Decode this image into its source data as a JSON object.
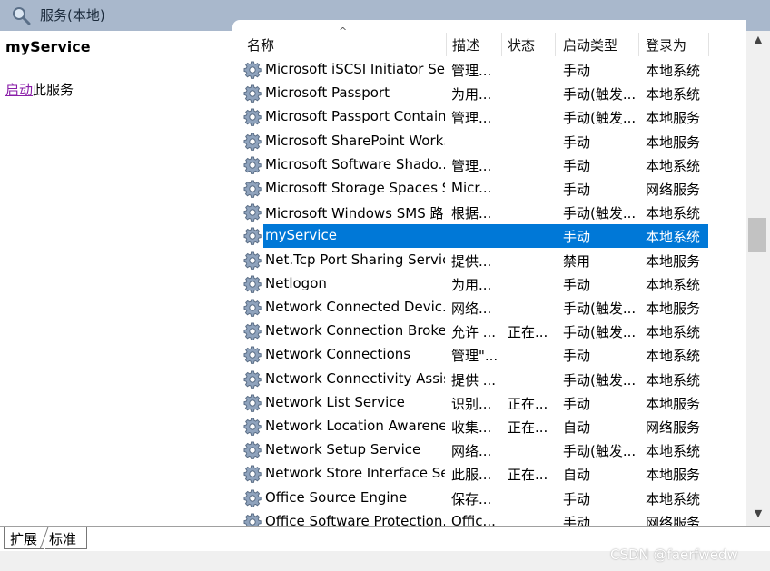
{
  "window": {
    "title": "服务(本地)",
    "title_icon": "search-icon"
  },
  "left_pane": {
    "service_name": "myService",
    "action_link": "启动",
    "action_suffix": "此服务"
  },
  "columns": [
    "名称",
    "描述",
    "状态",
    "启动类型",
    "登录为"
  ],
  "services": [
    {
      "name": "Microsoft iSCSI Initiator Ser...",
      "desc": "管理...",
      "status": "",
      "startup": "手动",
      "logon": "本地系统"
    },
    {
      "name": "Microsoft Passport",
      "desc": "为用...",
      "status": "",
      "startup": "手动(触发...",
      "logon": "本地系统"
    },
    {
      "name": "Microsoft Passport Container",
      "desc": "管理...",
      "status": "",
      "startup": "手动(触发...",
      "logon": "本地服务"
    },
    {
      "name": "Microsoft SharePoint Work...",
      "desc": "",
      "status": "",
      "startup": "手动",
      "logon": "本地服务"
    },
    {
      "name": "Microsoft Software Shado...",
      "desc": "管理...",
      "status": "",
      "startup": "手动",
      "logon": "本地系统"
    },
    {
      "name": "Microsoft Storage Spaces S...",
      "desc": "Micr...",
      "status": "",
      "startup": "手动",
      "logon": "网络服务"
    },
    {
      "name": "Microsoft Windows SMS 路...",
      "desc": "根据...",
      "status": "",
      "startup": "手动(触发...",
      "logon": "本地系统"
    },
    {
      "name": "myService",
      "desc": "",
      "status": "",
      "startup": "手动",
      "logon": "本地系统",
      "selected": true
    },
    {
      "name": "Net.Tcp Port Sharing Service",
      "desc": "提供...",
      "status": "",
      "startup": "禁用",
      "logon": "本地服务"
    },
    {
      "name": "Netlogon",
      "desc": "为用...",
      "status": "",
      "startup": "手动",
      "logon": "本地系统"
    },
    {
      "name": "Network Connected Devic...",
      "desc": "网络...",
      "status": "",
      "startup": "手动(触发...",
      "logon": "本地服务"
    },
    {
      "name": "Network Connection Broker",
      "desc": "允许 ...",
      "status": "正在...",
      "startup": "手动(触发...",
      "logon": "本地系统"
    },
    {
      "name": "Network Connections",
      "desc": "管理\"...",
      "status": "",
      "startup": "手动",
      "logon": "本地系统"
    },
    {
      "name": "Network Connectivity Assis...",
      "desc": "提供 ...",
      "status": "",
      "startup": "手动(触发...",
      "logon": "本地系统"
    },
    {
      "name": "Network List Service",
      "desc": "识别...",
      "status": "正在...",
      "startup": "手动",
      "logon": "本地服务"
    },
    {
      "name": "Network Location Awarene...",
      "desc": "收集...",
      "status": "正在...",
      "startup": "自动",
      "logon": "网络服务"
    },
    {
      "name": "Network Setup Service",
      "desc": "网络...",
      "status": "",
      "startup": "手动(触发...",
      "logon": "本地系统"
    },
    {
      "name": "Network Store Interface Se...",
      "desc": "此服...",
      "status": "正在...",
      "startup": "自动",
      "logon": "本地服务"
    },
    {
      "name": "Office  Source Engine",
      "desc": "保存...",
      "status": "",
      "startup": "手动",
      "logon": "本地系统"
    },
    {
      "name": "Office Software Protection...",
      "desc": "Offic...",
      "status": "",
      "startup": "手动",
      "logon": "网络服务"
    }
  ],
  "tabs": [
    "扩展",
    "标准"
  ],
  "watermark": "CSDN @faerfwedw",
  "colors": {
    "selection": "#0078d7",
    "titlebar": "#a9b8cc",
    "link": "#8a1ea8"
  }
}
